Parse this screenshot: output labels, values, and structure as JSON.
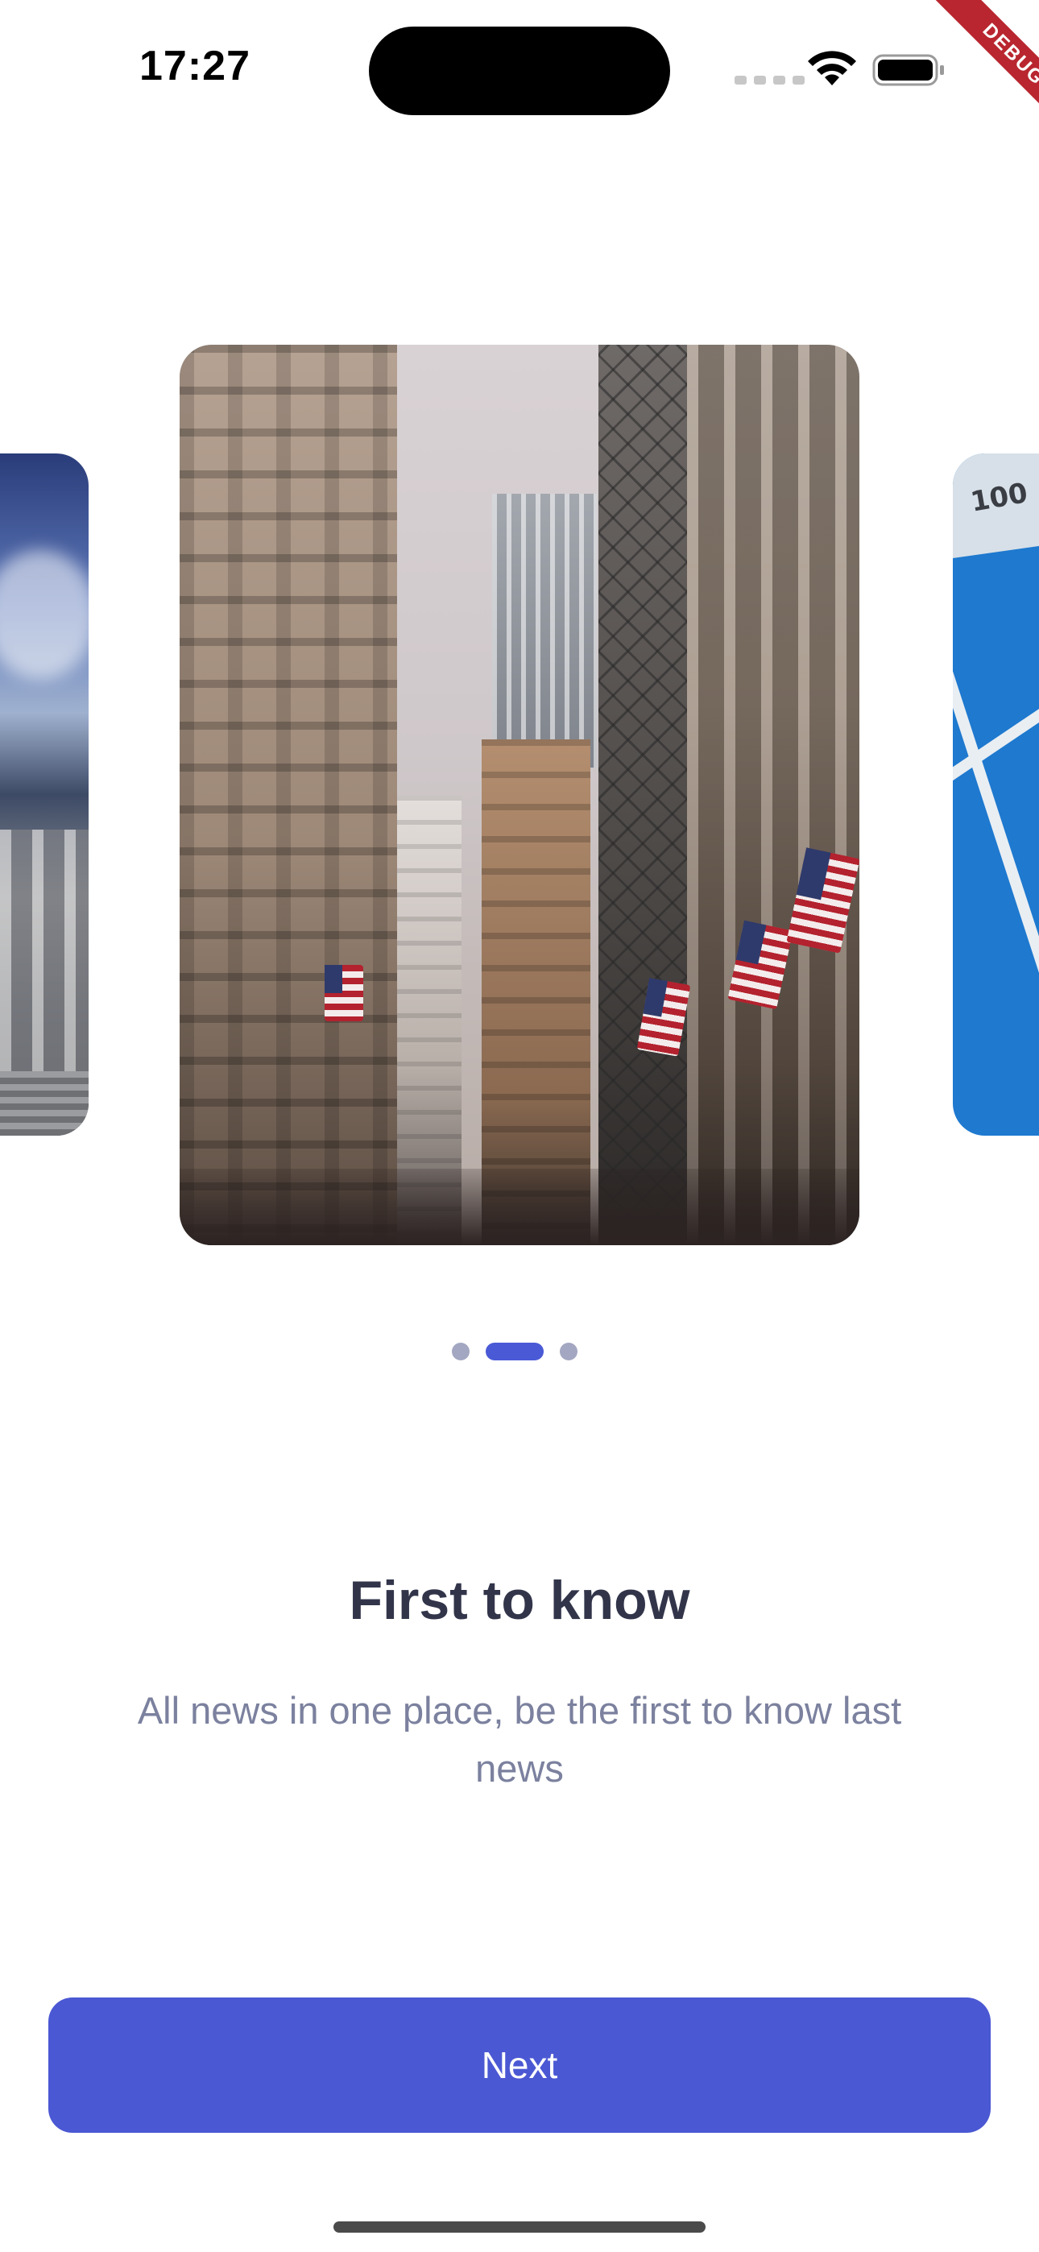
{
  "status_bar": {
    "time": "17:27",
    "icons": [
      "cellular-signal-icon",
      "wifi-icon",
      "battery-icon"
    ]
  },
  "debug_banner": {
    "label": "DEBUG"
  },
  "carousel": {
    "right_card_label": "100",
    "active_page": 2,
    "page_count": 3
  },
  "onboarding": {
    "title": "First to know",
    "description": "All news in one place, be the first to know last news"
  },
  "actions": {
    "next_label": "Next"
  },
  "colors": {
    "primary": "#4B58D3",
    "title_text": "#32354A",
    "description_text": "#7B819E",
    "inactive_dot": "#A3A7C1"
  }
}
